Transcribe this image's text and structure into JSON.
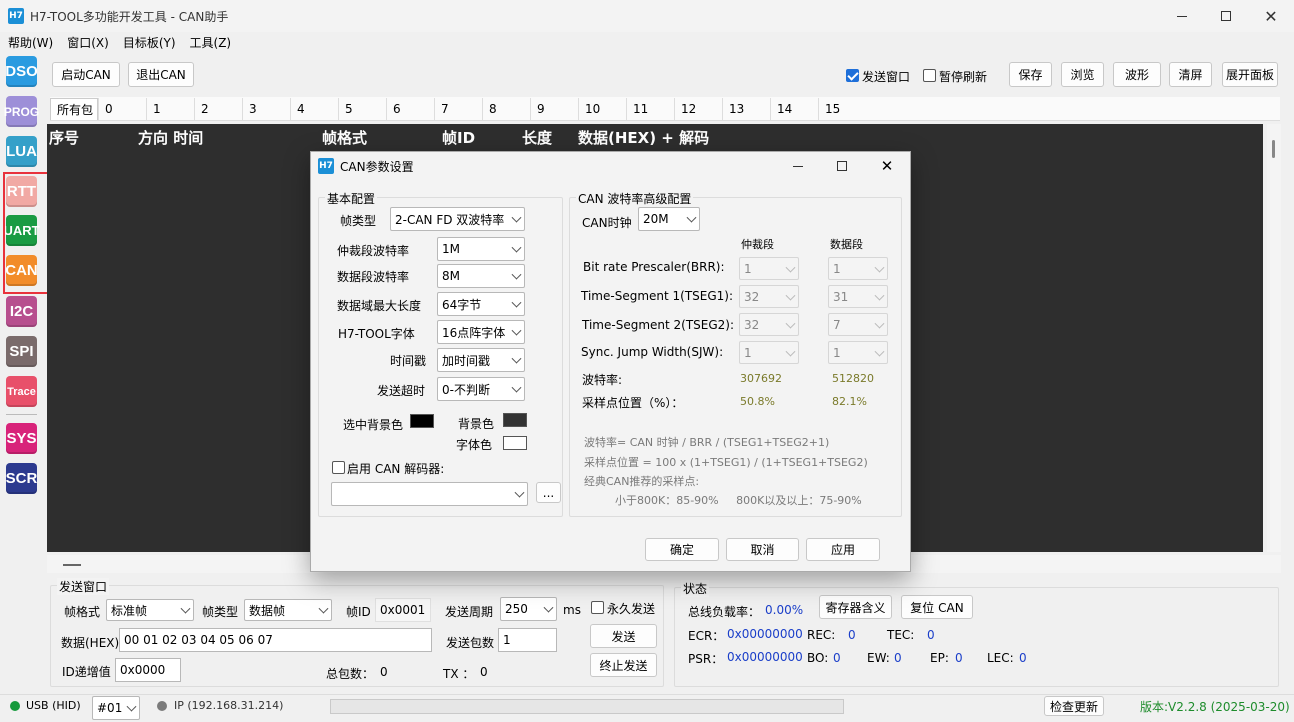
{
  "window": {
    "logo": "H7",
    "title": "H7-TOOL多功能开发工具 - CAN助手"
  },
  "menu": [
    "帮助(W)",
    "窗口(X)",
    "目标板(Y)",
    "工具(Z)"
  ],
  "sidebar": [
    "DSO",
    "PROG",
    "LUA",
    "RTT",
    "UART",
    "CAN",
    "I2C",
    "SPI",
    "Trace",
    "SYS",
    "SCR"
  ],
  "toolbar": {
    "start": "启动CAN",
    "exit": "退出CAN",
    "send_window": "发送窗口",
    "pause_refresh": "暂停刷新",
    "save": "保存",
    "browse": "浏览",
    "wave": "波形",
    "clear": "清屏",
    "expand": "展开面板"
  },
  "tabs": [
    "所有包",
    "0",
    "1",
    "2",
    "3",
    "4",
    "5",
    "6",
    "7",
    "8",
    "9",
    "10",
    "11",
    "12",
    "13",
    "14",
    "15"
  ],
  "columns": [
    "序号",
    "方向 时间",
    "帧格式",
    "帧ID",
    "长度",
    "数据(HEX) + 解码"
  ],
  "dialog": {
    "logo": "H7",
    "title": "CAN参数设置",
    "basic": {
      "title": "基本配置",
      "frame_type_label": "帧类型",
      "frame_type": "2-CAN FD 双波特率",
      "arb_label": "仲裁段波特率",
      "arb": "1M",
      "data_label": "数据段波特率",
      "data": "8M",
      "maxlen_label": "数据域最大长度",
      "maxlen": "64字节",
      "font_label": "H7-TOOL字体",
      "font": "16点阵字体",
      "ts_label": "时间戳",
      "ts": "加时间戳",
      "timeout_label": "发送超时",
      "timeout": "0-不判断",
      "selbg_label": "选中背景色",
      "bg_label": "背景色",
      "fg_label": "字体色",
      "decoder_label": "启用 CAN 解码器:",
      "browse": "...",
      "color_selbg": "#000000",
      "color_bg": "#333333",
      "color_fg": "#ffffff"
    },
    "adv": {
      "title": "CAN 波特率高级配置",
      "clock_label": "CAN时钟",
      "clock": "20M",
      "col_arb": "仲裁段",
      "col_data": "数据段",
      "rows": [
        {
          "label": "Bit rate  Prescaler(BRR):",
          "arb": "1",
          "data": "1"
        },
        {
          "label": "Time-Segment 1(TSEG1):",
          "arb": "32",
          "data": "31"
        },
        {
          "label": "Time-Segment 2(TSEG2):",
          "arb": "32",
          "data": "7"
        },
        {
          "label": "Sync. Jump Width(SJW):",
          "arb": "1",
          "data": "1"
        }
      ],
      "baud_label": "波特率:",
      "baud_arb": "307692",
      "baud_data": "512820",
      "sp_label": "采样点位置（%）：",
      "sp_arb": "50.8%",
      "sp_data": "82.1%",
      "f1": "波特率= CAN 时钟 / BRR / (TSEG1+TSEG2+1)",
      "f2": "采样点位置 = 100 x (1+TSEG1) / (1+TSEG1+TSEG2)",
      "f3": "经典CAN推荐的采样点:",
      "f4": "小于800K：85-90%     800K以及以上：75-90%"
    },
    "ok": "确定",
    "cancel": "取消",
    "apply": "应用"
  },
  "send": {
    "title": "发送窗口",
    "fmt_label": "帧格式",
    "fmt": "标准帧",
    "type_label": "帧类型",
    "type": "数据帧",
    "id_label": "帧ID",
    "id": "0x0001",
    "period_label": "发送周期",
    "period": "250",
    "ms": "ms",
    "forever": "永久发送",
    "data_label": "数据(HEX)",
    "data": "00 01 02 03 04 05 06 07",
    "count_label": "发送包数",
    "count": "1",
    "send": "发送",
    "stop": "终止发送",
    "inc_label": "ID递增值",
    "inc": "0x0000",
    "total_label": "总包数：",
    "total": "0",
    "tx_label": "TX ：",
    "tx": "0"
  },
  "status": {
    "title": "状态",
    "load_label": "总线负载率：",
    "load": "0.00%",
    "reg_btn": "寄存器含义",
    "reset_btn": "复位 CAN",
    "ecr_label": "ECR：",
    "ecr": "0x00000000",
    "rec_label": "REC:",
    "rec": "0",
    "tec_label": "TEC:",
    "tec": "0",
    "psr_label": "PSR：",
    "psr": "0x00000000",
    "bo_label": "BO:",
    "bo": "0",
    "ew_label": "EW:",
    "ew": "0",
    "ep_label": "EP:",
    "ep": "0",
    "lec_label": "LEC:",
    "lec": "0"
  },
  "statusbar": {
    "usb": "USB (HID)",
    "port": "#01",
    "ip": "IP (192.168.31.214)",
    "update": "检查更新",
    "version": "版本:V2.2.8 (2025-03-20)"
  }
}
